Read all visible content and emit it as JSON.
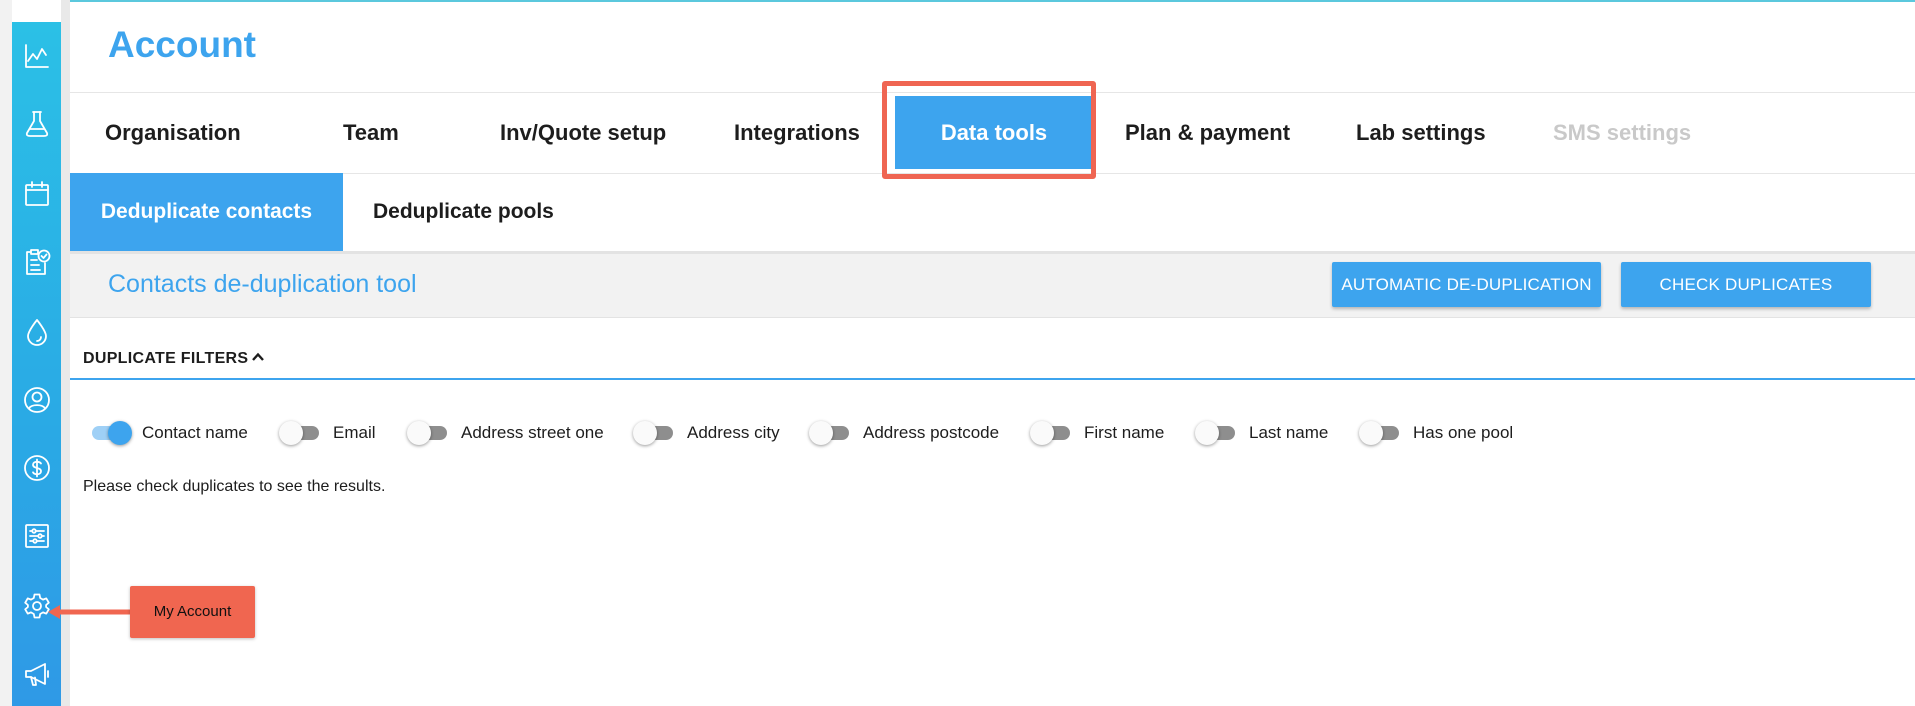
{
  "sidebar": {
    "items": [
      {
        "icon": "activity-chart-icon"
      },
      {
        "icon": "flask-icon"
      },
      {
        "icon": "calendar-icon"
      },
      {
        "icon": "clipboard-check-icon"
      },
      {
        "icon": "water-drop-icon"
      },
      {
        "icon": "user-circle-icon"
      },
      {
        "icon": "dollar-circle-icon"
      },
      {
        "icon": "sliders-panel-icon"
      },
      {
        "icon": "gear-icon"
      },
      {
        "icon": "megaphone-icon"
      }
    ]
  },
  "header": {
    "title": "Account"
  },
  "tabs": [
    {
      "label": "Organisation",
      "state": "normal"
    },
    {
      "label": "Team",
      "state": "normal"
    },
    {
      "label": "Inv/Quote setup",
      "state": "normal"
    },
    {
      "label": "Integrations",
      "state": "normal"
    },
    {
      "label": "Data tools",
      "state": "active"
    },
    {
      "label": "Plan & payment",
      "state": "normal"
    },
    {
      "label": "Lab settings",
      "state": "normal"
    },
    {
      "label": "SMS settings",
      "state": "disabled"
    }
  ],
  "subtabs": [
    {
      "label": "Deduplicate contacts",
      "state": "active"
    },
    {
      "label": "Deduplicate pools",
      "state": "normal"
    }
  ],
  "toolbar": {
    "title": "Contacts de-duplication tool",
    "auto_button": "AUTOMATIC DE-DUPLICATION",
    "check_button": "CHECK DUPLICATES"
  },
  "filters": {
    "header": "DUPLICATE FILTERS",
    "items": [
      {
        "label": "Contact name",
        "on": true
      },
      {
        "label": "Email",
        "on": false
      },
      {
        "label": "Address street one",
        "on": false
      },
      {
        "label": "Address city",
        "on": false
      },
      {
        "label": "Address postcode",
        "on": false
      },
      {
        "label": "First name",
        "on": false
      },
      {
        "label": "Last name",
        "on": false
      },
      {
        "label": "Has one pool",
        "on": false
      }
    ]
  },
  "results": {
    "empty_message": "Please check duplicates to see the results."
  },
  "annotation": {
    "callout": "My Account"
  },
  "colors": {
    "accent": "#3da4ee",
    "sidebar": "#2aa9e5",
    "highlight": "#ef6552",
    "callout": "#f06650",
    "disabled": "#c9c9c9"
  }
}
